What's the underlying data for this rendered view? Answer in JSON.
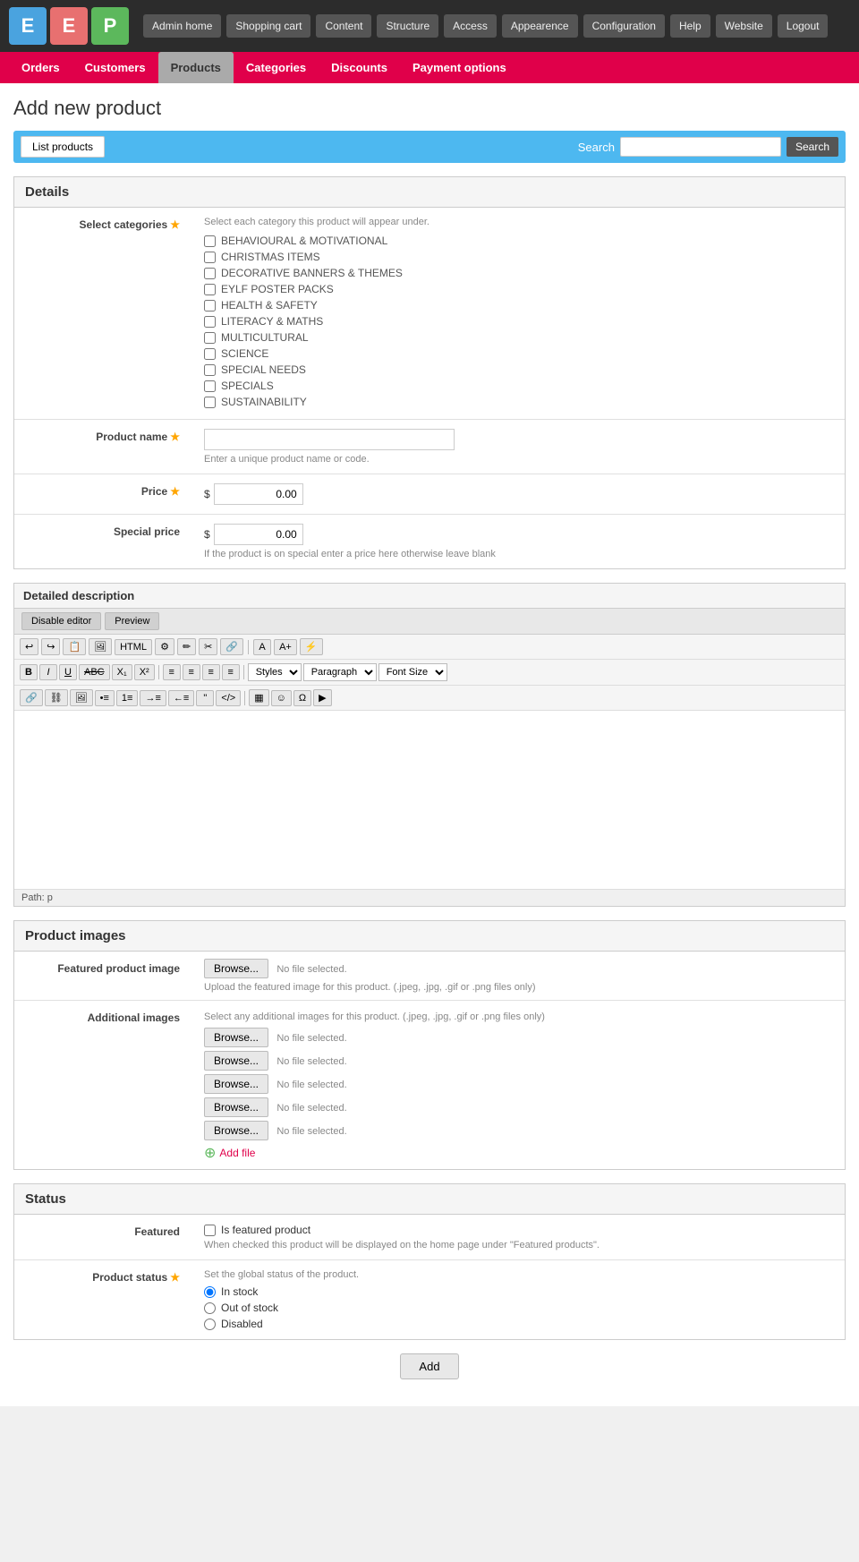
{
  "logos": [
    {
      "letter": "E",
      "class": "logo-e1"
    },
    {
      "letter": "E",
      "class": "logo-e2"
    },
    {
      "letter": "P",
      "class": "logo-p"
    }
  ],
  "topNav": {
    "items": [
      {
        "label": "Admin home",
        "key": "admin-home"
      },
      {
        "label": "Shopping cart",
        "key": "shopping-cart"
      },
      {
        "label": "Content",
        "key": "content"
      },
      {
        "label": "Structure",
        "key": "structure"
      },
      {
        "label": "Access",
        "key": "access"
      },
      {
        "label": "Appearence",
        "key": "appearence"
      },
      {
        "label": "Configuration",
        "key": "configuration"
      },
      {
        "label": "Help",
        "key": "help"
      },
      {
        "label": "Website",
        "key": "website"
      },
      {
        "label": "Logout",
        "key": "logout"
      }
    ]
  },
  "secNav": {
    "items": [
      {
        "label": "Orders",
        "key": "orders",
        "active": false
      },
      {
        "label": "Customers",
        "key": "customers",
        "active": false
      },
      {
        "label": "Products",
        "key": "products",
        "active": true
      },
      {
        "label": "Categories",
        "key": "categories",
        "active": false
      },
      {
        "label": "Discounts",
        "key": "discounts",
        "active": false
      },
      {
        "label": "Payment options",
        "key": "payment-options",
        "active": false
      }
    ]
  },
  "page": {
    "title": "Add new product"
  },
  "searchBar": {
    "listProductsLabel": "List products",
    "searchLabel": "Search",
    "searchPlaceholder": "",
    "searchBtnLabel": "Search"
  },
  "details": {
    "sectionTitle": "Details",
    "selectCategories": {
      "label": "Select categories",
      "instruction": "Select each category this product will appear under.",
      "categories": [
        "BEHAVIOURAL & MOTIVATIONAL",
        "CHRISTMAS ITEMS",
        "DECORATIVE BANNERS & THEMES",
        "EYLF POSTER PACKS",
        "HEALTH & SAFETY",
        "LITERACY & MATHS",
        "MULTICULTURAL",
        "SCIENCE",
        "SPECIAL NEEDS",
        "SPECIALS",
        "SUSTAINABILITY"
      ]
    },
    "productName": {
      "label": "Product name",
      "placeholder": "",
      "hint": "Enter a unique product name or code."
    },
    "price": {
      "label": "Price",
      "currency": "$",
      "value": "0.00"
    },
    "specialPrice": {
      "label": "Special price",
      "currency": "$",
      "value": "0.00",
      "hint": "If the product is on special enter a price here otherwise leave blank"
    }
  },
  "description": {
    "title": "Detailed description",
    "tabs": [
      {
        "label": "Disable editor",
        "active": false
      },
      {
        "label": "Preview",
        "active": false
      }
    ],
    "toolbar1": [
      "↩",
      "↪",
      "📋",
      "🖼",
      "HTML",
      "⚙",
      "✏",
      "✂",
      "🔗",
      "A",
      "A+",
      "⚡"
    ],
    "toolbar2Bold": "B",
    "toolbar2Italic": "I",
    "toolbar2Underline": "U",
    "toolbar2Strikethrough": "ABC",
    "toolbar2Sub": "X₁",
    "toolbar2Sup": "X²",
    "stylesDefault": "Styles",
    "paragraphDefault": "Paragraph",
    "fontSizeDefault": "Font Size",
    "pathLabel": "Path: p"
  },
  "productImages": {
    "sectionTitle": "Product images",
    "featuredImage": {
      "label": "Featured product image",
      "browseLabel": "Browse...",
      "fileLabel": "No file selected.",
      "hint": "Upload the featured image for this product. (.jpeg, .jpg, .gif or .png files only)"
    },
    "additionalImages": {
      "label": "Additional images",
      "instruction": "Select any additional images for this product. (.jpeg, .jpg, .gif or .png files only)",
      "browseLabel": "Browse...",
      "fileLabel": "No file selected.",
      "count": 5
    },
    "addFileLabel": "Add file"
  },
  "status": {
    "sectionTitle": "Status",
    "featured": {
      "label": "Featured",
      "checkboxLabel": "Is featured product",
      "note": "When checked this product will be displayed on the home page under \"Featured products\"."
    },
    "productStatus": {
      "label": "Product status",
      "hint": "Set the global status of the product.",
      "options": [
        {
          "label": "In stock",
          "value": "in_stock",
          "checked": true
        },
        {
          "label": "Out of stock",
          "value": "out_of_stock",
          "checked": false
        },
        {
          "label": "Disabled",
          "value": "disabled",
          "checked": false
        }
      ]
    }
  },
  "addButton": {
    "label": "Add"
  }
}
